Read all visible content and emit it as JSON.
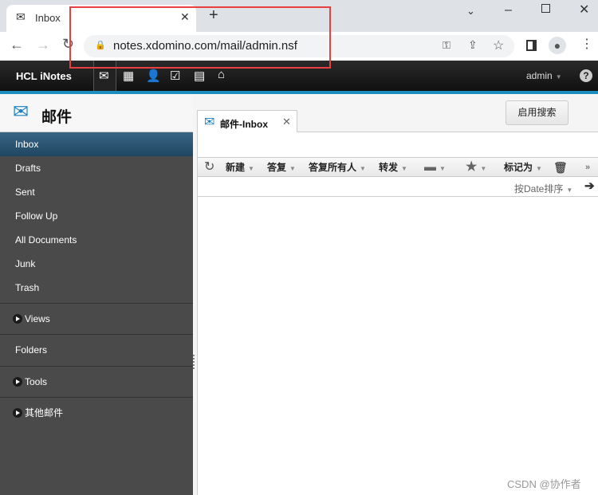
{
  "browser": {
    "tab_title": "Inbox",
    "url": "notes.xdomino.com/mail/admin.nsf"
  },
  "app": {
    "brand": "HCL iNotes",
    "user": "admin",
    "help": "?"
  },
  "left": {
    "title": "邮件",
    "items": [
      "Inbox",
      "Drafts",
      "Sent",
      "Follow Up",
      "All Documents",
      "Junk",
      "Trash"
    ],
    "sections": [
      "Views",
      "Folders",
      "Tools",
      "其他邮件"
    ]
  },
  "main": {
    "tab_label": "邮件-Inbox",
    "search_button": "启用搜索",
    "toolbar": {
      "new": "新建",
      "reply": "答复",
      "reply_all": "答复所有人",
      "forward": "转发",
      "mark_as": "标记为"
    },
    "sort": "按Date排序"
  },
  "watermark": "CSDN @协作者",
  "colors": {
    "accent": "#1a8fc0",
    "selected": "#2b5470",
    "highlight_box": "#e8403f"
  }
}
